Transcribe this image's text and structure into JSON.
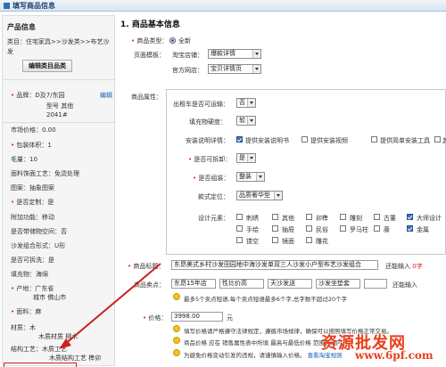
{
  "header": {
    "title": "填写商品信息"
  },
  "sidebar": {
    "title": "产品信息",
    "category": "类目：住宅家具>>沙发类>>布艺沙发",
    "edit_button": "编辑类目品类",
    "product_name": "品牌：D及7/东园",
    "model": "型号 其他",
    "model_no": "2041#",
    "edit_link": "编辑",
    "market_price": "市场价格：0.00",
    "pkg": "包装体积：1",
    "hair": "毛量：10",
    "fabric": "面料饰面工艺：免烫处理",
    "pattern": "图案：抽象图案",
    "custom": "是否定制：是",
    "attach": "附加功能：移动",
    "assembly": "是否带储物空间：否",
    "shape": "沙发组合形式：U形",
    "detach": "是否可拆洗：是",
    "fill": "填充物：海绵",
    "origin1": "产地：广东省",
    "origin2": "城市 佛山市",
    "frame": "面料：麻",
    "material1": "材质：木",
    "material2": "木质材质 柳木",
    "craft1": "结构工艺：木质工艺",
    "craft2": "木质结构工艺 榫卯",
    "style": "风格：美式乡村"
  },
  "main": {
    "section_title": "1. 商品基本信息",
    "type_label": "商品类型：",
    "type_value": "全新",
    "template_label": "页面模板：",
    "taobao_label": "淘宝店铺：",
    "taobao_value": "爆款详情",
    "official_label": "官方网店：",
    "official_value": "宝贝详情页",
    "attr_label": "商品属性：",
    "ship_label": "出租车是否可运输：",
    "ship_value": "否",
    "hard_label": "填充物硬度：",
    "hard_value": "软",
    "install_label": "安装说明详情：",
    "install_opts": [
      "提供安装说明书",
      "提供安装视频",
      "提供简单安装工具",
      "其"
    ],
    "fold_label": "是否可拆卸：",
    "fold_value": "是",
    "assemble_label": "是否组装：",
    "assemble_value": "整装",
    "style_label": "款式定位：",
    "style_value": "品质奢华型",
    "design_label": "设计元素：",
    "design_opts": [
      [
        "刺绣",
        "其他",
        "卯榫",
        "雕刻",
        "古董",
        "大师设计"
      ],
      [
        "手绘",
        "抽屉",
        "民俗",
        "罗马柱",
        "藤",
        "金属"
      ],
      [
        "镂空",
        "镜面",
        "雕花"
      ]
    ],
    "title_label": "商品标题：",
    "title_value": "东昂美式乡村沙发田园地中海沙发单双三人沙发小户型布艺沙发组合",
    "title_hint": "还能输入",
    "title_count": "0字",
    "selling_label": "商品卖点：",
    "selling_values": [
      "东昂15年店",
      "性比价高",
      "天沙发送",
      "沙发坐垫套"
    ],
    "selling_hint": "还能输入",
    "selling_tip": "最多5个卖点短语,每个卖点短语最多6个字,总字数不超过20个字",
    "price_label": "价格：",
    "price_value": "3998.00",
    "price_unit": "元",
    "price_tip1": "填写价格请严格遵守法律规定，遵循市场规律，确保可以按照填写价格正常交易。",
    "price_tip2": "商品价格 应在 销售属性表中所填 最高与最低价格 范围区间内。",
    "price_tip3": "为避免价格变动引发的违规，请谨慎输入价格。",
    "price_tip3_link": "查看淘宝规则"
  },
  "watermark": {
    "text1": "资源批发网",
    "text2": "www.6pf.com"
  },
  "colors": {
    "accent": "#1a5bb5",
    "required": "#e02020",
    "annotation": "#d01f1f",
    "watermark": "#e8401c"
  }
}
